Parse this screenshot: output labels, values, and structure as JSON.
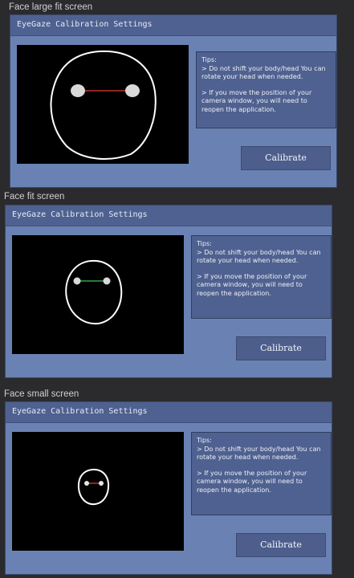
{
  "screens": [
    {
      "caption": "Face large fit screen",
      "window_title": "EyeGaze Calibration Settings",
      "gaze_line_color": "#c0342b",
      "tips_heading": "Tips:",
      "tip_1": "> Do not shift your body/head You can rotate your head when needed.",
      "tip_2": "> If you move the position of your camera window, you will need to reopen the application.",
      "button_label": "Calibrate"
    },
    {
      "caption": "Face fit screen",
      "window_title": "EyeGaze Calibration Settings",
      "gaze_line_color": "#2fa84a",
      "tips_heading": "Tips:",
      "tip_1": "> Do not shift your body/head You can rotate your head when needed.",
      "tip_2": "> If you move the position of your camera window, you will need to reopen the application.",
      "button_label": "Calibrate"
    },
    {
      "caption": "Face small screen",
      "window_title": "EyeGaze Calibration Settings",
      "gaze_line_color": "#c0342b",
      "tips_heading": "Tips:",
      "tip_1": "> Do not shift your body/head You can rotate your head when needed.",
      "tip_2": "> If you move the position of your camera window, you will need to reopen the application.",
      "button_label": "Calibrate"
    }
  ]
}
